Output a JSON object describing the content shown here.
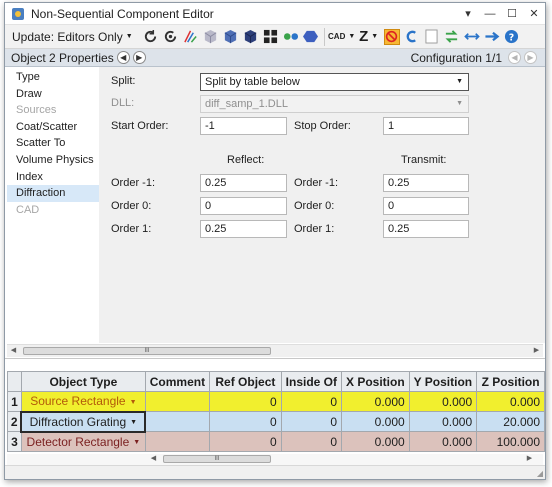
{
  "window": {
    "title": "Non-Sequential Component Editor",
    "controls": {
      "dropdown": "▾",
      "minimize": "—",
      "maximize": "☐",
      "close": "✕"
    }
  },
  "toolbar": {
    "update_label": "Update: Editors Only",
    "cad_label": "CAD",
    "z_label": "Z",
    "icons": [
      "refresh-icon",
      "refresh-all-icon",
      "ray-trace-icon",
      "cube-gray-icon",
      "cube-blue-icon",
      "cube-dark-icon",
      "grid-icon",
      "spheres-icon",
      "hexagon-icon",
      "cad-icon",
      "z-icon",
      "no-entry-icon",
      "undo-icon",
      "page-icon",
      "swap-arrows-icon",
      "double-arrow-icon",
      "arrow-right-icon",
      "help-icon"
    ],
    "colors": {
      "highlight": "#f7b733",
      "blue": "#2a74c9",
      "green": "#3aa34a"
    }
  },
  "property_bar": {
    "title": "Object  2 Properties",
    "configuration": "Configuration 1/1"
  },
  "sidenav": {
    "items": [
      {
        "label": "Type",
        "state": "normal"
      },
      {
        "label": "Draw",
        "state": "normal"
      },
      {
        "label": "Sources",
        "state": "disabled"
      },
      {
        "label": "Coat/Scatter",
        "state": "normal"
      },
      {
        "label": "Scatter To",
        "state": "normal"
      },
      {
        "label": "Volume Physics",
        "state": "normal"
      },
      {
        "label": "Index",
        "state": "normal"
      },
      {
        "label": "Diffraction",
        "state": "active"
      },
      {
        "label": "CAD",
        "state": "disabled"
      }
    ]
  },
  "diffraction": {
    "split_label": "Split:",
    "split_value": "Split by table below",
    "dll_label": "DLL:",
    "dll_value": "diff_samp_1.DLL",
    "start_order_label": "Start Order:",
    "start_order_value": "-1",
    "stop_order_label": "Stop Order:",
    "stop_order_value": "1",
    "reflect_header": "Reflect:",
    "transmit_header": "Transmit:",
    "reflect": [
      {
        "label": "Order -1:",
        "value": "0.25"
      },
      {
        "label": "Order 0:",
        "value": "0"
      },
      {
        "label": "Order 1:",
        "value": "0.25"
      }
    ],
    "transmit": [
      {
        "label": "Order -1:",
        "value": "0.25"
      },
      {
        "label": "Order 0:",
        "value": "0"
      },
      {
        "label": "Order 1:",
        "value": "0.25"
      }
    ]
  },
  "scrollbar": {
    "thumb_grip": "III"
  },
  "grid": {
    "columns": [
      "",
      "Object Type",
      "Comment",
      "Ref Object",
      "Inside Of",
      "X Position",
      "Y Position",
      "Z Position"
    ],
    "rows": [
      {
        "num": "1",
        "object_type": "Source Rectangle",
        "comment": "",
        "ref_object": "0",
        "inside_of": "0",
        "x": "0.000",
        "y": "0.000",
        "z": "0.000",
        "color": "#f1ef2e"
      },
      {
        "num": "2",
        "object_type": "Diffraction Grating",
        "comment": "",
        "ref_object": "0",
        "inside_of": "0",
        "x": "0.000",
        "y": "0.000",
        "z": "20.000",
        "color": "#c9dff2"
      },
      {
        "num": "3",
        "object_type": "Detector Rectangle",
        "comment": "",
        "ref_object": "0",
        "inside_of": "0",
        "x": "0.000",
        "y": "0.000",
        "z": "100.000",
        "color": "#dcc2bc"
      }
    ]
  }
}
